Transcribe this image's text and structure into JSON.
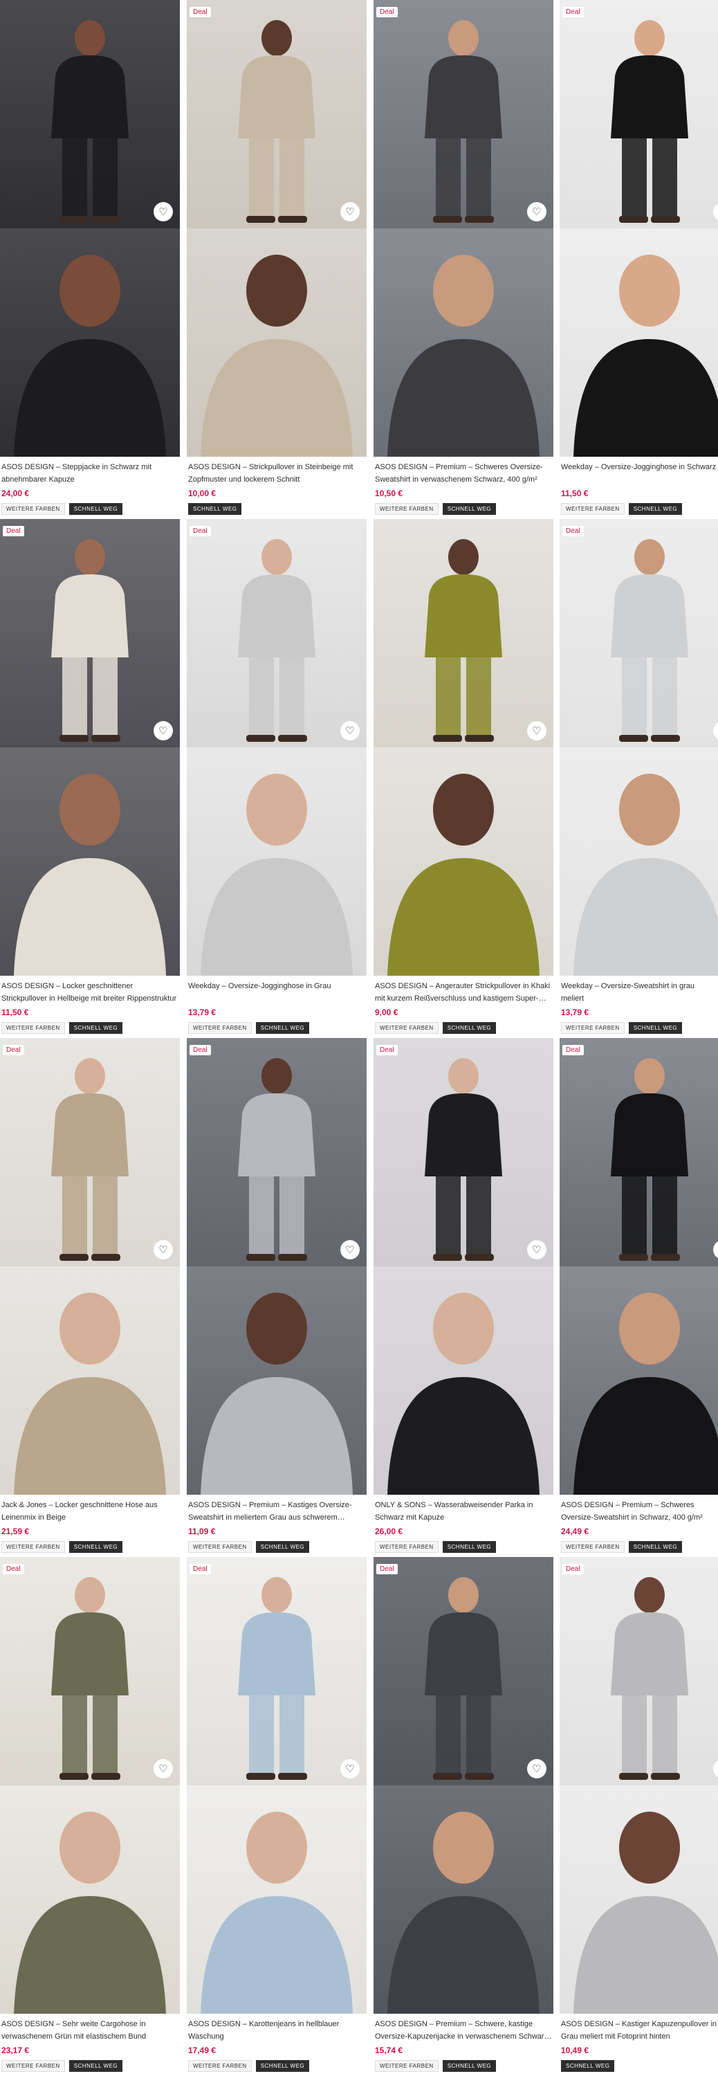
{
  "products": [
    {
      "title": "ASOS DESIGN – Steppjacke in Schwarz mit abnehmbarer Kapuze",
      "price": "24,00 €",
      "deal": "",
      "tags": [
        "WEITERE FARBEN",
        "SCHNELL WEG"
      ],
      "bg1": "#4a4a4f",
      "bg2": "#2e2e33",
      "cloth": "#1c1c1e",
      "skin": "#7a4c3a"
    },
    {
      "title": "ASOS DESIGN – Strickpullover in Steinbeige mit Zopfmuster und lockerem Schnitt",
      "price": "10,00 €",
      "deal": "Deal",
      "tags": [
        "SCHNELL WEG"
      ],
      "bg1": "#d9d5cf",
      "bg2": "#cdc6bc",
      "cloth": "#c7b8a4",
      "skin": "#5a3a2c"
    },
    {
      "title": "ASOS DESIGN – Premium – Schweres Oversize-Sweatshirt in verwaschenem Schwarz, 400 g/m²",
      "price": "10,50 €",
      "deal": "Deal",
      "tags": [
        "WEITERE FARBEN",
        "SCHNELL WEG"
      ],
      "bg1": "#8b8d94",
      "bg2": "#6d6f76",
      "cloth": "#3b3b40",
      "skin": "#c89a7e"
    },
    {
      "title": "Weekday – Oversize-Jogginghose in Schwarz",
      "price": "11,50 €",
      "deal": "Deal",
      "tags": [
        "WEITERE FARBEN",
        "SCHNELL WEG"
      ],
      "bg1": "#eeeeee",
      "bg2": "#e2e2e2",
      "cloth": "#151515",
      "skin": "#d9a889"
    },
    {
      "title": "ASOS DESIGN – Locker geschnittener Strickpullover in Hellbeige mit breiter Rippenstruktur",
      "price": "11,50 €",
      "deal": "Deal",
      "tags": [
        "WEITERE FARBEN",
        "SCHNELL WEG"
      ],
      "bg1": "#6b6b70",
      "bg2": "#4f4f55",
      "cloth": "#e3ddd3",
      "skin": "#9a6a52"
    },
    {
      "title": "Weekday – Oversize-Jogginghose in Grau",
      "price": "13,79 €",
      "deal": "Deal",
      "tags": [
        "WEITERE FARBEN",
        "SCHNELL WEG"
      ],
      "bg1": "#e9e9e9",
      "bg2": "#d8d8d8",
      "cloth": "#c9c9c9",
      "skin": "#d7b099"
    },
    {
      "title": "ASOS DESIGN – Angerauter Strickpullover in Khaki mit kurzem Reißverschluss und kastigem Super-…",
      "price": "9,00 €",
      "deal": "",
      "tags": [
        "WEITERE FARBEN",
        "SCHNELL WEG"
      ],
      "bg1": "#e5e3df",
      "bg2": "#d8d4cc",
      "cloth": "#8b8a2b",
      "skin": "#5a3a2c"
    },
    {
      "title": "Weekday – Oversize-Sweatshirt in grau meliert",
      "price": "13,79 €",
      "deal": "Deal",
      "tags": [
        "WEITERE FARBEN",
        "SCHNELL WEG"
      ],
      "bg1": "#ededed",
      "bg2": "#e3e3e3",
      "cloth": "#cfd0d2",
      "skin": "#c99a7c"
    },
    {
      "title": "Jack & Jones – Locker geschnittene Hose aus Leinenmix in Beige",
      "price": "21,59 €",
      "deal": "Deal",
      "tags": [
        "WEITERE FARBEN",
        "SCHNELL WEG"
      ],
      "bg1": "#e8e6e2",
      "bg2": "#dcd8d1",
      "cloth": "#b9a68c",
      "skin": "#d7b099"
    },
    {
      "title": "ASOS DESIGN – Premium – Kastiges Oversize-Sweatshirt in meliertem Grau aus schwerem…",
      "price": "11,09 €",
      "deal": "Deal",
      "tags": [
        "WEITERE FARBEN",
        "SCHNELL WEG"
      ],
      "bg1": "#7d7f86",
      "bg2": "#63656c",
      "cloth": "#b7b9c0",
      "skin": "#5a3a2c"
    },
    {
      "title": "ONLY & SONS – Wasserabweisender Parka in Schwarz mit Kapuze",
      "price": "26,00 €",
      "deal": "Deal",
      "tags": [
        "WEITERE FARBEN",
        "SCHNELL WEG"
      ],
      "bg1": "#dcdadd",
      "bg2": "#cfcdd1",
      "cloth": "#1d1d20",
      "skin": "#d7b099"
    },
    {
      "title": "ASOS DESIGN – Premium – Schweres Oversize-Sweatshirt in Schwarz, 400 g/m²",
      "price": "24,49 €",
      "deal": "Deal",
      "tags": [
        "WEITERE FARBEN",
        "SCHNELL WEG"
      ],
      "bg1": "#8a8c93",
      "bg2": "#6a6c73",
      "cloth": "#141416",
      "skin": "#c99a7c"
    },
    {
      "title": "ASOS DESIGN – Sehr weite Cargohose in verwaschenem Grün mit elastischem Bund",
      "price": "23,17 €",
      "deal": "Deal",
      "tags": [
        "WEITERE FARBEN",
        "SCHNELL WEG"
      ],
      "bg1": "#ebe9e4",
      "bg2": "#dcd8cf",
      "cloth": "#6b6b52",
      "skin": "#d7b099"
    },
    {
      "title": "ASOS DESIGN – Karottenjeans in hellblauer Waschung",
      "price": "17,49 €",
      "deal": "Deal",
      "tags": [
        "WEITERE FARBEN",
        "SCHNELL WEG"
      ],
      "bg1": "#efeeec",
      "bg2": "#e2e0dc",
      "cloth": "#a9c0d4",
      "skin": "#d7b099"
    },
    {
      "title": "ASOS DESIGN – Premium – Schwere, kastige Oversize-Kapuzenjacke in verwaschenem Schwar…",
      "price": "15,74 €",
      "deal": "Deal",
      "tags": [
        "WEITERE FARBEN",
        "SCHNELL WEG"
      ],
      "bg1": "#6f7178",
      "bg2": "#55575e",
      "cloth": "#3d3f46",
      "skin": "#c99a7c"
    },
    {
      "title": "ASOS DESIGN – Kastiger Kapuzenpullover in Grau meliert mit Fotoprint hinten",
      "price": "10,49 €",
      "deal": "Deal",
      "tags": [
        "SCHNELL WEG"
      ],
      "bg1": "#ededed",
      "bg2": "#e1e1e1",
      "cloth": "#b9b9bb",
      "skin": "#6b4436"
    }
  ],
  "icons": {
    "wishlist": "heart-icon"
  }
}
